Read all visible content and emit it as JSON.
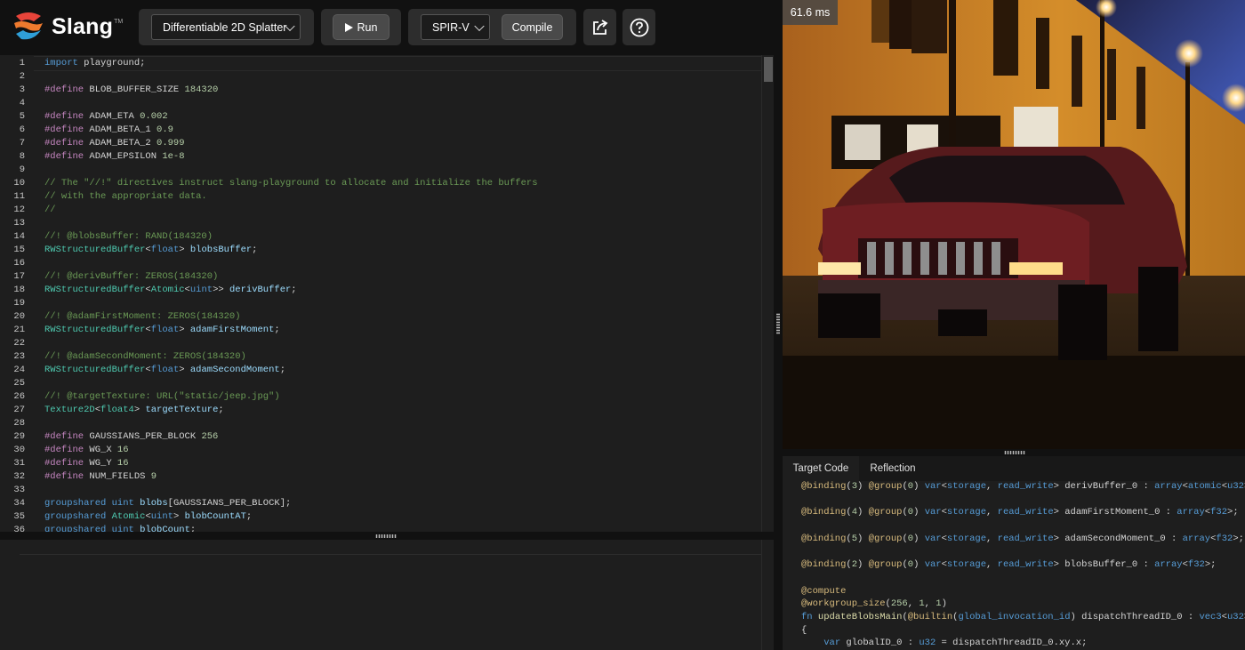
{
  "app": {
    "name": "Slang",
    "trademark": "TM"
  },
  "toolbar": {
    "demo_select": "Differentiable 2D Splatter",
    "run_label": "Run",
    "target_select": "SPIR-V",
    "compile_label": "Compile",
    "share_icon": "share-icon",
    "help_icon": "help-icon"
  },
  "editor": {
    "line_numbers": [
      "1",
      "2",
      "3",
      "4",
      "5",
      "6",
      "7",
      "8",
      "9",
      "10",
      "11",
      "12",
      "13",
      "14",
      "15",
      "16",
      "17",
      "18",
      "19",
      "20",
      "21",
      "22",
      "23",
      "24",
      "25",
      "26",
      "27",
      "28",
      "29",
      "30",
      "31",
      "32",
      "33",
      "34",
      "35",
      "36"
    ],
    "lines": [
      [
        [
          "kw",
          "import"
        ],
        [
          "d",
          " playground;"
        ]
      ],
      [],
      [
        [
          "mc",
          "#define"
        ],
        [
          "d",
          " BLOB_BUFFER_SIZE "
        ],
        [
          "nm",
          "184320"
        ]
      ],
      [],
      [
        [
          "mc",
          "#define"
        ],
        [
          "d",
          " ADAM_ETA "
        ],
        [
          "nm",
          "0.002"
        ]
      ],
      [
        [
          "mc",
          "#define"
        ],
        [
          "d",
          " ADAM_BETA_1 "
        ],
        [
          "nm",
          "0.9"
        ]
      ],
      [
        [
          "mc",
          "#define"
        ],
        [
          "d",
          " ADAM_BETA_2 "
        ],
        [
          "nm",
          "0.999"
        ]
      ],
      [
        [
          "mc",
          "#define"
        ],
        [
          "d",
          " ADAM_EPSILON "
        ],
        [
          "nm",
          "1e-8"
        ]
      ],
      [],
      [
        [
          "cm",
          "// The \"//!\" directives instruct slang-playground to allocate and initialize the buffers"
        ]
      ],
      [
        [
          "cm",
          "// with the appropriate data."
        ]
      ],
      [
        [
          "cm",
          "//"
        ]
      ],
      [],
      [
        [
          "cm",
          "//! @blobsBuffer: RAND(184320)"
        ]
      ],
      [
        [
          "ty",
          "RWStructuredBuffer"
        ],
        [
          "d",
          "<"
        ],
        [
          "kw",
          "float"
        ],
        [
          "d",
          "> "
        ],
        [
          "vr",
          "blobsBuffer"
        ],
        [
          "d",
          ";"
        ]
      ],
      [],
      [
        [
          "cm",
          "//! @derivBuffer: ZEROS(184320)"
        ]
      ],
      [
        [
          "ty",
          "RWStructuredBuffer"
        ],
        [
          "d",
          "<"
        ],
        [
          "ty",
          "Atomic"
        ],
        [
          "d",
          "<"
        ],
        [
          "kw",
          "uint"
        ],
        [
          "d",
          ">> "
        ],
        [
          "vr",
          "derivBuffer"
        ],
        [
          "d",
          ";"
        ]
      ],
      [],
      [
        [
          "cm",
          "//! @adamFirstMoment: ZEROS(184320)"
        ]
      ],
      [
        [
          "ty",
          "RWStructuredBuffer"
        ],
        [
          "d",
          "<"
        ],
        [
          "kw",
          "float"
        ],
        [
          "d",
          "> "
        ],
        [
          "vr",
          "adamFirstMoment"
        ],
        [
          "d",
          ";"
        ]
      ],
      [],
      [
        [
          "cm",
          "//! @adamSecondMoment: ZEROS(184320)"
        ]
      ],
      [
        [
          "ty",
          "RWStructuredBuffer"
        ],
        [
          "d",
          "<"
        ],
        [
          "kw",
          "float"
        ],
        [
          "d",
          "> "
        ],
        [
          "vr",
          "adamSecondMoment"
        ],
        [
          "d",
          ";"
        ]
      ],
      [],
      [
        [
          "cm",
          "//! @targetTexture: URL(\"static/jeep.jpg\")"
        ]
      ],
      [
        [
          "ty",
          "Texture2D"
        ],
        [
          "d",
          "<"
        ],
        [
          "ty",
          "float4"
        ],
        [
          "d",
          "> "
        ],
        [
          "vr",
          "targetTexture"
        ],
        [
          "d",
          ";"
        ]
      ],
      [],
      [
        [
          "mc",
          "#define"
        ],
        [
          "d",
          " GAUSSIANS_PER_BLOCK "
        ],
        [
          "nm",
          "256"
        ]
      ],
      [
        [
          "mc",
          "#define"
        ],
        [
          "d",
          " WG_X "
        ],
        [
          "nm",
          "16"
        ]
      ],
      [
        [
          "mc",
          "#define"
        ],
        [
          "d",
          " WG_Y "
        ],
        [
          "nm",
          "16"
        ]
      ],
      [
        [
          "mc",
          "#define"
        ],
        [
          "d",
          " NUM_FIELDS "
        ],
        [
          "nm",
          "9"
        ]
      ],
      [],
      [
        [
          "kw",
          "groupshared"
        ],
        [
          "d",
          " "
        ],
        [
          "kw",
          "uint"
        ],
        [
          "d",
          " "
        ],
        [
          "vr",
          "blobs"
        ],
        [
          "d",
          "[GAUSSIANS_PER_BLOCK];"
        ]
      ],
      [
        [
          "kw",
          "groupshared"
        ],
        [
          "d",
          " "
        ],
        [
          "ty",
          "Atomic"
        ],
        [
          "d",
          "<"
        ],
        [
          "kw",
          "uint"
        ],
        [
          "d",
          "> "
        ],
        [
          "vr",
          "blobCountAT"
        ],
        [
          "d",
          ";"
        ]
      ],
      [
        [
          "kw",
          "groupshared"
        ],
        [
          "d",
          " "
        ],
        [
          "kw",
          "uint"
        ],
        [
          "d",
          " "
        ],
        [
          "vr",
          "blobCount"
        ],
        [
          "d",
          ";"
        ]
      ]
    ]
  },
  "preview": {
    "frame_time": "61.6 ms",
    "image_description": "jeep"
  },
  "output_panel": {
    "tabs": [
      "Target Code",
      "Reflection"
    ],
    "active_tab": "Target Code",
    "lines": [
      [
        [
          "at",
          "@binding"
        ],
        [
          "d",
          "("
        ],
        [
          "nm",
          "3"
        ],
        [
          "d",
          ") "
        ],
        [
          "at",
          "@group"
        ],
        [
          "d",
          "("
        ],
        [
          "nm",
          "0"
        ],
        [
          "d",
          ") "
        ],
        [
          "kw",
          "var"
        ],
        [
          "d",
          "<"
        ],
        [
          "kw",
          "storage"
        ],
        [
          "d",
          ", "
        ],
        [
          "kw",
          "read_write"
        ],
        [
          "d",
          "> derivBuffer_0 : "
        ],
        [
          "kw",
          "array"
        ],
        [
          "d",
          "<"
        ],
        [
          "kw",
          "atomic"
        ],
        [
          "d",
          "<"
        ],
        [
          "kw",
          "u32"
        ],
        [
          "d",
          ">>;"
        ]
      ],
      [],
      [
        [
          "at",
          "@binding"
        ],
        [
          "d",
          "("
        ],
        [
          "nm",
          "4"
        ],
        [
          "d",
          ") "
        ],
        [
          "at",
          "@group"
        ],
        [
          "d",
          "("
        ],
        [
          "nm",
          "0"
        ],
        [
          "d",
          ") "
        ],
        [
          "kw",
          "var"
        ],
        [
          "d",
          "<"
        ],
        [
          "kw",
          "storage"
        ],
        [
          "d",
          ", "
        ],
        [
          "kw",
          "read_write"
        ],
        [
          "d",
          "> adamFirstMoment_0 : "
        ],
        [
          "kw",
          "array"
        ],
        [
          "d",
          "<"
        ],
        [
          "kw",
          "f32"
        ],
        [
          "d",
          ">;"
        ]
      ],
      [],
      [
        [
          "at",
          "@binding"
        ],
        [
          "d",
          "("
        ],
        [
          "nm",
          "5"
        ],
        [
          "d",
          ") "
        ],
        [
          "at",
          "@group"
        ],
        [
          "d",
          "("
        ],
        [
          "nm",
          "0"
        ],
        [
          "d",
          ") "
        ],
        [
          "kw",
          "var"
        ],
        [
          "d",
          "<"
        ],
        [
          "kw",
          "storage"
        ],
        [
          "d",
          ", "
        ],
        [
          "kw",
          "read_write"
        ],
        [
          "d",
          "> adamSecondMoment_0 : "
        ],
        [
          "kw",
          "array"
        ],
        [
          "d",
          "<"
        ],
        [
          "kw",
          "f32"
        ],
        [
          "d",
          ">;"
        ]
      ],
      [],
      [
        [
          "at",
          "@binding"
        ],
        [
          "d",
          "("
        ],
        [
          "nm",
          "2"
        ],
        [
          "d",
          ") "
        ],
        [
          "at",
          "@group"
        ],
        [
          "d",
          "("
        ],
        [
          "nm",
          "0"
        ],
        [
          "d",
          ") "
        ],
        [
          "kw",
          "var"
        ],
        [
          "d",
          "<"
        ],
        [
          "kw",
          "storage"
        ],
        [
          "d",
          ", "
        ],
        [
          "kw",
          "read_write"
        ],
        [
          "d",
          "> blobsBuffer_0 : "
        ],
        [
          "kw",
          "array"
        ],
        [
          "d",
          "<"
        ],
        [
          "kw",
          "f32"
        ],
        [
          "d",
          ">;"
        ]
      ],
      [],
      [
        [
          "at",
          "@compute"
        ]
      ],
      [
        [
          "at",
          "@workgroup_size"
        ],
        [
          "d",
          "("
        ],
        [
          "nm",
          "256"
        ],
        [
          "d",
          ", "
        ],
        [
          "nm",
          "1"
        ],
        [
          "d",
          ", "
        ],
        [
          "nm",
          "1"
        ],
        [
          "d",
          ")"
        ]
      ],
      [
        [
          "kw",
          "fn"
        ],
        [
          "d",
          " "
        ],
        [
          "fn",
          "updateBlobsMain"
        ],
        [
          "d",
          "("
        ],
        [
          "at",
          "@builtin"
        ],
        [
          "d",
          "("
        ],
        [
          "kw",
          "global_invocation_id"
        ],
        [
          "d",
          ") dispatchThreadID_0 : "
        ],
        [
          "kw",
          "vec3"
        ],
        [
          "d",
          "<"
        ],
        [
          "kw",
          "u32"
        ],
        [
          "d",
          ">)"
        ]
      ],
      [
        [
          "d",
          "{"
        ]
      ],
      [
        [
          "d",
          "    "
        ],
        [
          "kw",
          "var"
        ],
        [
          "d",
          " globalID_0 : "
        ],
        [
          "kw",
          "u32"
        ],
        [
          "d",
          " = dispatchThreadID_0.xy.x;"
        ]
      ]
    ]
  }
}
